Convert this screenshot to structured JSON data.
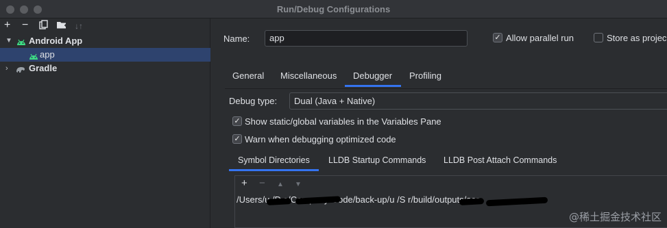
{
  "window": {
    "title": "Run/Debug Configurations"
  },
  "left_toolbar": {
    "add": "+",
    "remove": "−"
  },
  "tree": [
    {
      "label": "Android App",
      "expanded": true
    },
    {
      "label": "app",
      "selected": true
    },
    {
      "label": "Gradle",
      "expanded": false
    }
  ],
  "config": {
    "name_label": "Name:",
    "name_value": "app",
    "allow_parallel_label": "Allow parallel run",
    "allow_parallel_checked": true,
    "store_project_label": "Store as projec",
    "store_project_checked": false
  },
  "tabs": [
    {
      "label": "General"
    },
    {
      "label": "Miscellaneous"
    },
    {
      "label": "Debugger",
      "active": true
    },
    {
      "label": "Profiling"
    }
  ],
  "debugger": {
    "debug_type_label": "Debug type:",
    "debug_type_value": "Dual (Java + Native)",
    "show_static_label": "Show static/global variables in the Variables Pane",
    "show_static_checked": true,
    "warn_optimized_label": "Warn when debugging optimized code",
    "warn_optimized_checked": true
  },
  "subtabs": [
    {
      "label": "Symbol Directories",
      "active": true
    },
    {
      "label": "LLDB Startup Commands"
    },
    {
      "label": "LLDB Post Attach Commands"
    }
  ],
  "symbol_list": {
    "add": "+",
    "remove": "−",
    "paths": [
      "/Users/u        /D        s/Company-Code/back-up/u        /S                    r/build/outputs/aar"
    ]
  },
  "watermark": "@稀土掘金技术社区",
  "colors": {
    "accent": "#3574f0",
    "selection": "#2e436e",
    "android_green": "#3ddc84"
  }
}
